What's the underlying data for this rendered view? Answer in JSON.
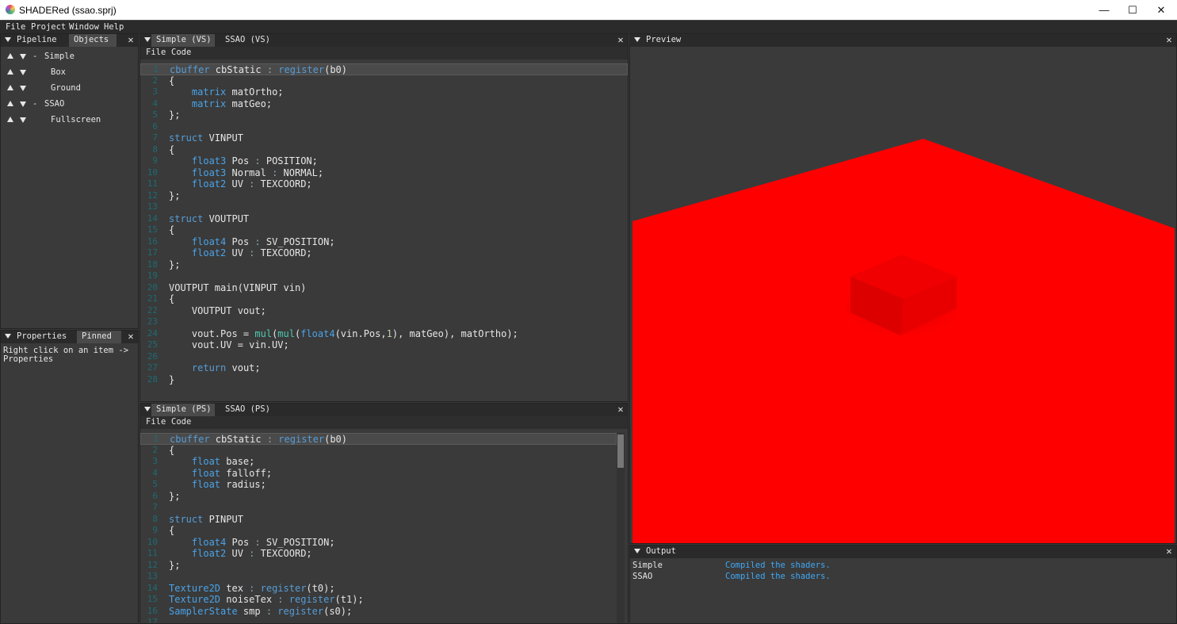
{
  "window": {
    "title": "SHADERed (ssao.sprj)",
    "minimize_icon": "minimize-icon",
    "maximize_icon": "maximize-icon",
    "close_icon": "close-icon"
  },
  "menu": [
    "File",
    "Project",
    "Window",
    "Help"
  ],
  "pipeline_panel": {
    "tabs": [
      "Pipeline",
      "Objects"
    ],
    "items": [
      {
        "label": "Simple",
        "expander": "-"
      },
      {
        "label": "Box"
      },
      {
        "label": "Ground"
      },
      {
        "label": "SSAO",
        "expander": "-"
      },
      {
        "label": "Fullscreen"
      }
    ]
  },
  "properties_panel": {
    "tabs": [
      "Properties",
      "Pinned"
    ],
    "hint_line1": "Right click on an item ->",
    "hint_line2": "Properties"
  },
  "vs_editor": {
    "tabs": [
      "Simple (VS)",
      "SSAO (VS)"
    ],
    "menu": [
      "File",
      "Code"
    ],
    "lines": [
      "cbuffer cbStatic : register(b0)",
      "{",
      "    matrix matOrtho;",
      "    matrix matGeo;",
      "};",
      "",
      "struct VINPUT",
      "{",
      "    float3 Pos : POSITION;",
      "    float3 Normal : NORMAL;",
      "    float2 UV : TEXCOORD;",
      "};",
      "",
      "struct VOUTPUT",
      "{",
      "    float4 Pos : SV_POSITION;",
      "    float2 UV : TEXCOORD;",
      "};",
      "",
      "VOUTPUT main(VINPUT vin)",
      "{",
      "    VOUTPUT vout;",
      "",
      "    vout.Pos = mul(mul(float4(vin.Pos,1), matGeo), matOrtho);",
      "    vout.UV = vin.UV;",
      "",
      "    return vout;",
      "}"
    ]
  },
  "ps_editor": {
    "tabs": [
      "Simple (PS)",
      "SSAO (PS)"
    ],
    "menu": [
      "File",
      "Code"
    ],
    "lines": [
      "cbuffer cbStatic : register(b0)",
      "{",
      "    float base;",
      "    float falloff;",
      "    float radius;",
      "};",
      "",
      "struct PINPUT",
      "{",
      "    float4 Pos : SV_POSITION;",
      "    float2 UV : TEXCOORD;",
      "};",
      "",
      "Texture2D tex : register(t0);",
      "Texture2D noiseTex : register(t1);",
      "SamplerState smp : register(s0);",
      ""
    ]
  },
  "preview_panel": {
    "tab": "Preview",
    "scene_color": "#ff0000",
    "background": "#3a3a3a"
  },
  "output_panel": {
    "tab": "Output",
    "rows": [
      {
        "source": "Simple",
        "message": "Compiled the shaders."
      },
      {
        "source": "SSAO",
        "message": "Compiled the shaders."
      }
    ],
    "message_color": "#3fa9f5"
  },
  "colors": {
    "keyword": "#569cd6",
    "function": "#4ec9b0",
    "line_number": "#1e6b73",
    "panel_bg": "#3a3a3a",
    "tab_bg": "#2a2a2a"
  }
}
